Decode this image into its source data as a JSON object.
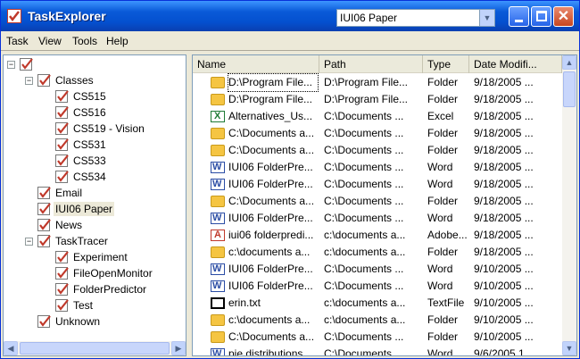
{
  "window": {
    "title": "TaskExplorer",
    "task_selector_value": "IUI06 Paper",
    "colors": {
      "titlebar": "#0450cf",
      "close": "#c8461f",
      "selection": "#ece9d8"
    }
  },
  "menu": [
    "Task",
    "View",
    "Tools",
    "Help"
  ],
  "tree": [
    {
      "label": "",
      "depth": 0,
      "expander": "−",
      "checked": true
    },
    {
      "label": "Classes",
      "depth": 1,
      "expander": "−",
      "checked": true
    },
    {
      "label": "CS515",
      "depth": 2,
      "checked": true
    },
    {
      "label": "CS516",
      "depth": 2,
      "checked": true
    },
    {
      "label": "CS519 - Vision",
      "depth": 2,
      "checked": true
    },
    {
      "label": "CS531",
      "depth": 2,
      "checked": true
    },
    {
      "label": "CS533",
      "depth": 2,
      "checked": true
    },
    {
      "label": "CS534",
      "depth": 2,
      "checked": true
    },
    {
      "label": "Email",
      "depth": 1,
      "checked": true
    },
    {
      "label": "IUI06 Paper",
      "depth": 1,
      "checked": true,
      "selected": true
    },
    {
      "label": "News",
      "depth": 1,
      "checked": true
    },
    {
      "label": "TaskTracer",
      "depth": 1,
      "expander": "−",
      "checked": true
    },
    {
      "label": "Experiment",
      "depth": 2,
      "checked": true
    },
    {
      "label": "FileOpenMonitor",
      "depth": 2,
      "checked": true
    },
    {
      "label": "FolderPredictor",
      "depth": 2,
      "checked": true
    },
    {
      "label": "Test",
      "depth": 2,
      "checked": true
    },
    {
      "label": "Unknown",
      "depth": 1,
      "checked": true
    }
  ],
  "list": {
    "columns": [
      "Name",
      "Path",
      "Type",
      "Date Modifi..."
    ],
    "rows": [
      {
        "icon": "folder",
        "name": "D:\\Program File...",
        "path": "D:\\Program File...",
        "type": "Folder",
        "date": "9/18/2005 ...",
        "focus": true
      },
      {
        "icon": "folder",
        "name": "D:\\Program File...",
        "path": "D:\\Program File...",
        "type": "Folder",
        "date": "9/18/2005 ..."
      },
      {
        "icon": "excel",
        "name": "Alternatives_Us...",
        "path": "C:\\Documents ...",
        "type": "Excel",
        "date": "9/18/2005 ..."
      },
      {
        "icon": "folder",
        "name": "C:\\Documents a...",
        "path": "C:\\Documents ...",
        "type": "Folder",
        "date": "9/18/2005 ..."
      },
      {
        "icon": "folder",
        "name": "C:\\Documents a...",
        "path": "C:\\Documents ...",
        "type": "Folder",
        "date": "9/18/2005 ..."
      },
      {
        "icon": "word",
        "name": "IUI06 FolderPre...",
        "path": "C:\\Documents ...",
        "type": "Word",
        "date": "9/18/2005 ..."
      },
      {
        "icon": "word",
        "name": "IUI06 FolderPre...",
        "path": "C:\\Documents ...",
        "type": "Word",
        "date": "9/18/2005 ..."
      },
      {
        "icon": "folder",
        "name": "C:\\Documents a...",
        "path": "C:\\Documents ...",
        "type": "Folder",
        "date": "9/18/2005 ..."
      },
      {
        "icon": "word",
        "name": "IUI06 FolderPre...",
        "path": "C:\\Documents ...",
        "type": "Word",
        "date": "9/18/2005 ..."
      },
      {
        "icon": "pdf",
        "name": "iui06 folderpredi...",
        "path": "c:\\documents a...",
        "type": "Adobe...",
        "date": "9/18/2005 ..."
      },
      {
        "icon": "folder",
        "name": "c:\\documents a...",
        "path": "c:\\documents a...",
        "type": "Folder",
        "date": "9/18/2005 ..."
      },
      {
        "icon": "word",
        "name": "IUI06 FolderPre...",
        "path": "C:\\Documents ...",
        "type": "Word",
        "date": "9/10/2005 ..."
      },
      {
        "icon": "word",
        "name": "IUI06 FolderPre...",
        "path": "C:\\Documents ...",
        "type": "Word",
        "date": "9/10/2005 ..."
      },
      {
        "icon": "text",
        "name": "erin.txt",
        "path": "c:\\documents a...",
        "type": "TextFile",
        "date": "9/10/2005 ..."
      },
      {
        "icon": "folder",
        "name": "c:\\documents a...",
        "path": "c:\\documents a...",
        "type": "Folder",
        "date": "9/10/2005 ..."
      },
      {
        "icon": "folder",
        "name": "C:\\Documents a...",
        "path": "C:\\Documents ...",
        "type": "Folder",
        "date": "9/10/2005 ..."
      },
      {
        "icon": "word",
        "name": "pie distributions",
        "path": "C:\\Documents ...",
        "type": "Word",
        "date": "9/6/2005 1..."
      }
    ]
  }
}
